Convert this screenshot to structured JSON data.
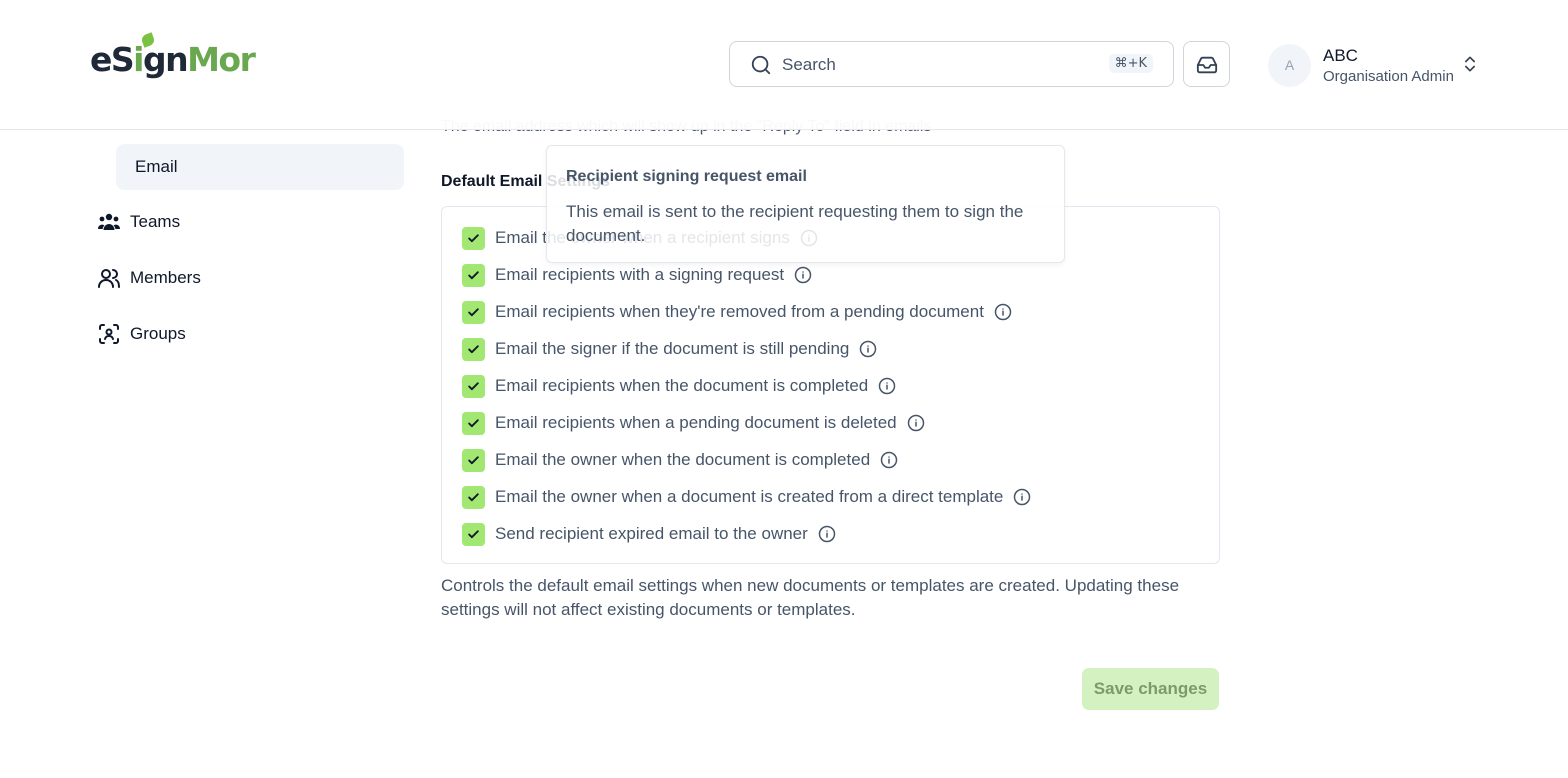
{
  "app": {
    "logo_text": "eSignMor",
    "brand_color": "#7cc242"
  },
  "header": {
    "search": {
      "label": "Search",
      "shortcut": "⌘+K"
    },
    "user": {
      "avatar_initial": "A",
      "name": "ABC",
      "role": "Organisation Admin"
    }
  },
  "sidebar": {
    "items": [
      {
        "label": "Email",
        "icon": "none",
        "active": true
      },
      {
        "label": "Teams",
        "icon": "users-icon"
      },
      {
        "label": "Members",
        "icon": "user-icon"
      },
      {
        "label": "Groups",
        "icon": "group-scan-icon"
      }
    ]
  },
  "main": {
    "reply_to_description": "The email address which will show up in the \"Reply To\" field in emails",
    "section_title": "Default Email Settings",
    "options": [
      {
        "label": "Email the owner when a recipient signs",
        "checked": true
      },
      {
        "label": "Email recipients with a signing request",
        "checked": true
      },
      {
        "label": "Email recipients when they're removed from a pending document",
        "checked": true
      },
      {
        "label": "Email the signer if the document is still pending",
        "checked": true
      },
      {
        "label": "Email recipients when the document is completed",
        "checked": true
      },
      {
        "label": "Email recipients when a pending document is deleted",
        "checked": true
      },
      {
        "label": "Email the owner when the document is completed",
        "checked": true
      },
      {
        "label": "Email the owner when a document is created from a direct template",
        "checked": true
      },
      {
        "label": "Send recipient expired email to the owner",
        "checked": true
      }
    ],
    "footnote": "Controls the default email settings when new documents or templates are created. Updating these settings will not affect existing documents or templates.",
    "save_label": "Save changes"
  },
  "tooltip": {
    "title": "Recipient signing request email",
    "body": "This email is sent to the recipient requesting them to sign the document."
  }
}
